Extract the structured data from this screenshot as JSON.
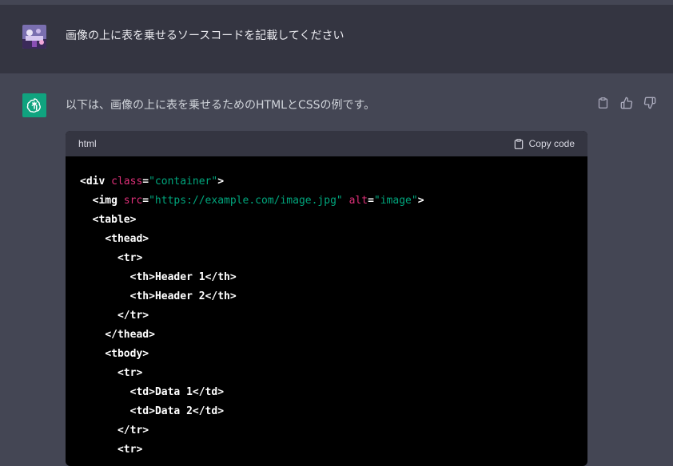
{
  "user_message": {
    "text": "画像の上に表を乗せるソースコードを記載してください",
    "avatar_icon": "user-avatar-image"
  },
  "assistant_message": {
    "text": "以下は、画像の上に表を乗せるためのHTMLとCSSの例です。",
    "avatar_icon": "openai-logo-icon",
    "accent_color": "#10a37f"
  },
  "actions": {
    "copy_icon": "clipboard-icon",
    "like_icon": "thumbs-up-icon",
    "dislike_icon": "thumbs-down-icon"
  },
  "code_block": {
    "language": "html",
    "copy_label": "Copy code",
    "lines": [
      [
        {
          "t": "tag",
          "v": "<div"
        },
        {
          "t": "plain",
          "v": " "
        },
        {
          "t": "attr",
          "v": "class"
        },
        {
          "t": "plain",
          "v": "="
        },
        {
          "t": "str",
          "v": "\"container\""
        },
        {
          "t": "tag",
          "v": ">"
        }
      ],
      [
        {
          "t": "plain",
          "v": "  "
        },
        {
          "t": "tag",
          "v": "<img"
        },
        {
          "t": "plain",
          "v": " "
        },
        {
          "t": "attr",
          "v": "src"
        },
        {
          "t": "plain",
          "v": "="
        },
        {
          "t": "str",
          "v": "\"https://example.com/image.jpg\""
        },
        {
          "t": "plain",
          "v": " "
        },
        {
          "t": "attr",
          "v": "alt"
        },
        {
          "t": "plain",
          "v": "="
        },
        {
          "t": "str",
          "v": "\"image\""
        },
        {
          "t": "tag",
          "v": ">"
        }
      ],
      [
        {
          "t": "plain",
          "v": "  "
        },
        {
          "t": "tag",
          "v": "<table>"
        }
      ],
      [
        {
          "t": "plain",
          "v": "    "
        },
        {
          "t": "tag",
          "v": "<thead>"
        }
      ],
      [
        {
          "t": "plain",
          "v": "      "
        },
        {
          "t": "tag",
          "v": "<tr>"
        }
      ],
      [
        {
          "t": "plain",
          "v": "        "
        },
        {
          "t": "tag",
          "v": "<th>"
        },
        {
          "t": "plain",
          "v": "Header 1"
        },
        {
          "t": "tag",
          "v": "</th>"
        }
      ],
      [
        {
          "t": "plain",
          "v": "        "
        },
        {
          "t": "tag",
          "v": "<th>"
        },
        {
          "t": "plain",
          "v": "Header 2"
        },
        {
          "t": "tag",
          "v": "</th>"
        }
      ],
      [
        {
          "t": "plain",
          "v": "      "
        },
        {
          "t": "tag",
          "v": "</tr>"
        }
      ],
      [
        {
          "t": "plain",
          "v": "    "
        },
        {
          "t": "tag",
          "v": "</thead>"
        }
      ],
      [
        {
          "t": "plain",
          "v": "    "
        },
        {
          "t": "tag",
          "v": "<tbody>"
        }
      ],
      [
        {
          "t": "plain",
          "v": "      "
        },
        {
          "t": "tag",
          "v": "<tr>"
        }
      ],
      [
        {
          "t": "plain",
          "v": "        "
        },
        {
          "t": "tag",
          "v": "<td>"
        },
        {
          "t": "plain",
          "v": "Data 1"
        },
        {
          "t": "tag",
          "v": "</td>"
        }
      ],
      [
        {
          "t": "plain",
          "v": "        "
        },
        {
          "t": "tag",
          "v": "<td>"
        },
        {
          "t": "plain",
          "v": "Data 2"
        },
        {
          "t": "tag",
          "v": "</td>"
        }
      ],
      [
        {
          "t": "plain",
          "v": "      "
        },
        {
          "t": "tag",
          "v": "</tr>"
        }
      ],
      [
        {
          "t": "plain",
          "v": "      "
        },
        {
          "t": "tag",
          "v": "<tr>"
        }
      ]
    ]
  },
  "colors": {
    "user_bg": "#343541",
    "assistant_bg": "#444654",
    "code_bg": "#000000",
    "code_header_bg": "#343541",
    "attr_color": "#df3079",
    "string_color": "#00a67d"
  }
}
